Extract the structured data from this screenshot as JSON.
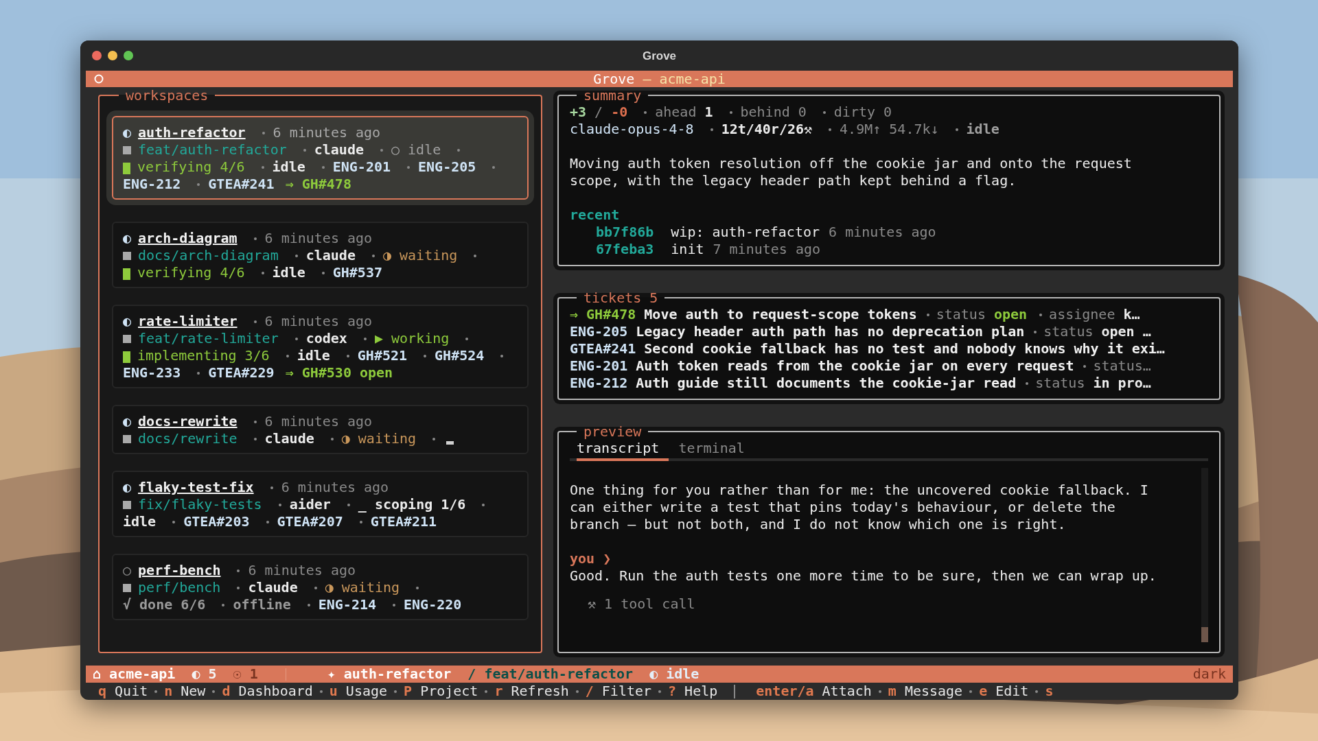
{
  "window": {
    "title": "Grove"
  },
  "header": {
    "app": "Grove",
    "project": "— acme-api"
  },
  "workspaces_panel": {
    "title": "workspaces"
  },
  "workspaces": [
    {
      "name": "auth-refactor",
      "glyph": "◐",
      "time": "6 minutes ago",
      "selected": true,
      "branch": "feat/auth-refactor",
      "agent": "claude",
      "state": {
        "text": "○ idle",
        "kind": "idle"
      },
      "phase": {
        "text": "verifying 4/6",
        "kind": "active"
      },
      "activity": {
        "text": "idle",
        "kind": "online"
      },
      "tickets": [
        "ENG-201",
        "ENG-205",
        "ENG-212",
        "GTEA#241"
      ],
      "pr": "⇒ GH#478"
    },
    {
      "name": "arch-diagram",
      "glyph": "◐",
      "time": "6 minutes ago",
      "selected": false,
      "branch": "docs/arch-diagram",
      "agent": "claude",
      "state": {
        "text": "◑ waiting",
        "kind": "waiting"
      },
      "phase": {
        "text": "verifying 4/6",
        "kind": "active"
      },
      "activity": {
        "text": "idle",
        "kind": "online"
      },
      "tickets": [
        "GH#537"
      ]
    },
    {
      "name": "rate-limiter",
      "glyph": "◐",
      "time": "6 minutes ago",
      "selected": false,
      "branch": "feat/rate-limiter",
      "agent": "codex",
      "state": {
        "text": "▶ working",
        "kind": "working"
      },
      "phase": {
        "text": "implementing 3/6",
        "kind": "active"
      },
      "activity": {
        "text": "idle",
        "kind": "online"
      },
      "tickets": [
        "GH#521",
        "GH#524",
        "ENG-233",
        "GTEA#229"
      ],
      "pr": "⇒ GH#530 open"
    },
    {
      "name": "docs-rewrite",
      "glyph": "◐",
      "time": "6 minutes ago",
      "selected": false,
      "branch": "docs/rewrite",
      "agent": "claude",
      "state": {
        "text": "◑ waiting",
        "kind": "waiting"
      },
      "phase": {
        "kind": "empty"
      }
    },
    {
      "name": "flaky-test-fix",
      "glyph": "◐",
      "time": "6 minutes ago",
      "selected": false,
      "branch": "fix/flaky-tests",
      "agent": "aider",
      "phase": {
        "text": "_ scoping 1/6",
        "kind": "pending"
      },
      "activity": {
        "text": "idle",
        "kind": "online"
      },
      "tickets": [
        "GTEA#203",
        "GTEA#207",
        "GTEA#211"
      ]
    },
    {
      "name": "perf-bench",
      "glyph": "○",
      "time": "6 minutes ago",
      "selected": false,
      "branch": "perf/bench",
      "agent": "claude",
      "state": {
        "text": "◑ waiting",
        "kind": "waiting"
      },
      "phase": {
        "text": "√ done 6/6",
        "kind": "done"
      },
      "activity": {
        "text": "offline",
        "kind": "offline"
      },
      "tickets": [
        "ENG-214",
        "ENG-220"
      ]
    }
  ],
  "summary": {
    "title": "summary",
    "diff_added": "+3",
    "diff_sep": "/",
    "diff_removed": "-0",
    "stats": [
      {
        "label": "ahead",
        "value": "1",
        "highlight": true
      },
      {
        "label": "behind",
        "value": "0",
        "highlight": false
      },
      {
        "label": "dirty",
        "value": "0",
        "highlight": false
      }
    ],
    "model": "claude-opus-4-8",
    "counts": "12t/40r/26⚒",
    "tokens": "4.9M↑ 54.7k↓",
    "state": "idle",
    "description": "Moving auth token resolution off the cookie jar and onto the request scope, with the legacy header path kept behind a flag.",
    "recent_label": "recent",
    "commits": [
      {
        "hash": "bb7f86b",
        "message": "wip: auth-refactor",
        "time": "6 minutes ago"
      },
      {
        "hash": "67feba3",
        "message": "init",
        "time": "7 minutes ago"
      }
    ]
  },
  "tickets": {
    "title": "tickets",
    "count": "5",
    "rows": [
      {
        "id": "⇒ GH#478",
        "title": "Move auth to request-scope tokens",
        "selected": true,
        "fields": [
          {
            "label": "status",
            "value": "open"
          },
          {
            "label": "assignee",
            "value": "k…"
          }
        ]
      },
      {
        "id": "ENG-205",
        "title": "Legacy header auth path has no deprecation plan",
        "selected": false,
        "fields": [
          {
            "label": "status",
            "value": "open …"
          }
        ]
      },
      {
        "id": "GTEA#241",
        "title": "Second cookie fallback has no test and nobody knows why it exi…",
        "selected": false,
        "fields": []
      },
      {
        "id": "ENG-201",
        "title": "Auth token reads from the cookie jar on every request",
        "selected": false,
        "fields": [
          {
            "label": "status…"
          }
        ]
      },
      {
        "id": "ENG-212",
        "title": "Auth guide still documents the cookie-jar read",
        "selected": false,
        "fields": [
          {
            "label": "status",
            "value": "in pro…"
          }
        ]
      }
    ]
  },
  "preview": {
    "title": "preview",
    "tabs": [
      {
        "label": "transcript",
        "selected": true
      },
      {
        "label": "terminal",
        "selected": false
      }
    ],
    "messages": [
      {
        "kind": "assistant",
        "text": "One thing for you rather than for me: the uncovered cookie fallback. I can either write a test that pins today's behaviour, or delete the branch — but not both, and I do not know which one is right."
      },
      {
        "kind": "user",
        "speaker": "you ❯",
        "text": "Good. Run the auth tests one more time to be sure, then we can wrap up."
      },
      {
        "kind": "tool",
        "text": "⚒ 1 tool call"
      }
    ]
  },
  "status_bar": {
    "left": [
      {
        "text": "⌂ acme-api",
        "kind": "project"
      },
      {
        "text": "◐ 5",
        "kind": "count"
      },
      {
        "text": "☉ 1",
        "kind": "dim"
      }
    ],
    "center": [
      {
        "text": "✦ auth-refactor",
        "kind": "workspace"
      },
      {
        "text": "/ feat/auth-refactor",
        "kind": "branch"
      },
      {
        "text": "◐ idle",
        "kind": "state"
      }
    ],
    "right": "dark"
  },
  "hints": [
    [
      {
        "key": "q",
        "label": "Quit"
      },
      {
        "key": "n",
        "label": "New"
      },
      {
        "key": "d",
        "label": "Dashboard"
      },
      {
        "key": "u",
        "label": "Usage"
      },
      {
        "key": "P",
        "label": "Project"
      },
      {
        "key": "r",
        "label": "Refresh"
      },
      {
        "key": "/",
        "label": "Filter"
      },
      {
        "key": "?",
        "label": "Help"
      }
    ],
    [
      {
        "key": "enter/a",
        "label": "Attach"
      },
      {
        "key": "m",
        "label": "Message"
      },
      {
        "key": "e",
        "label": "Edit"
      },
      {
        "key": "s"
      }
    ]
  ]
}
